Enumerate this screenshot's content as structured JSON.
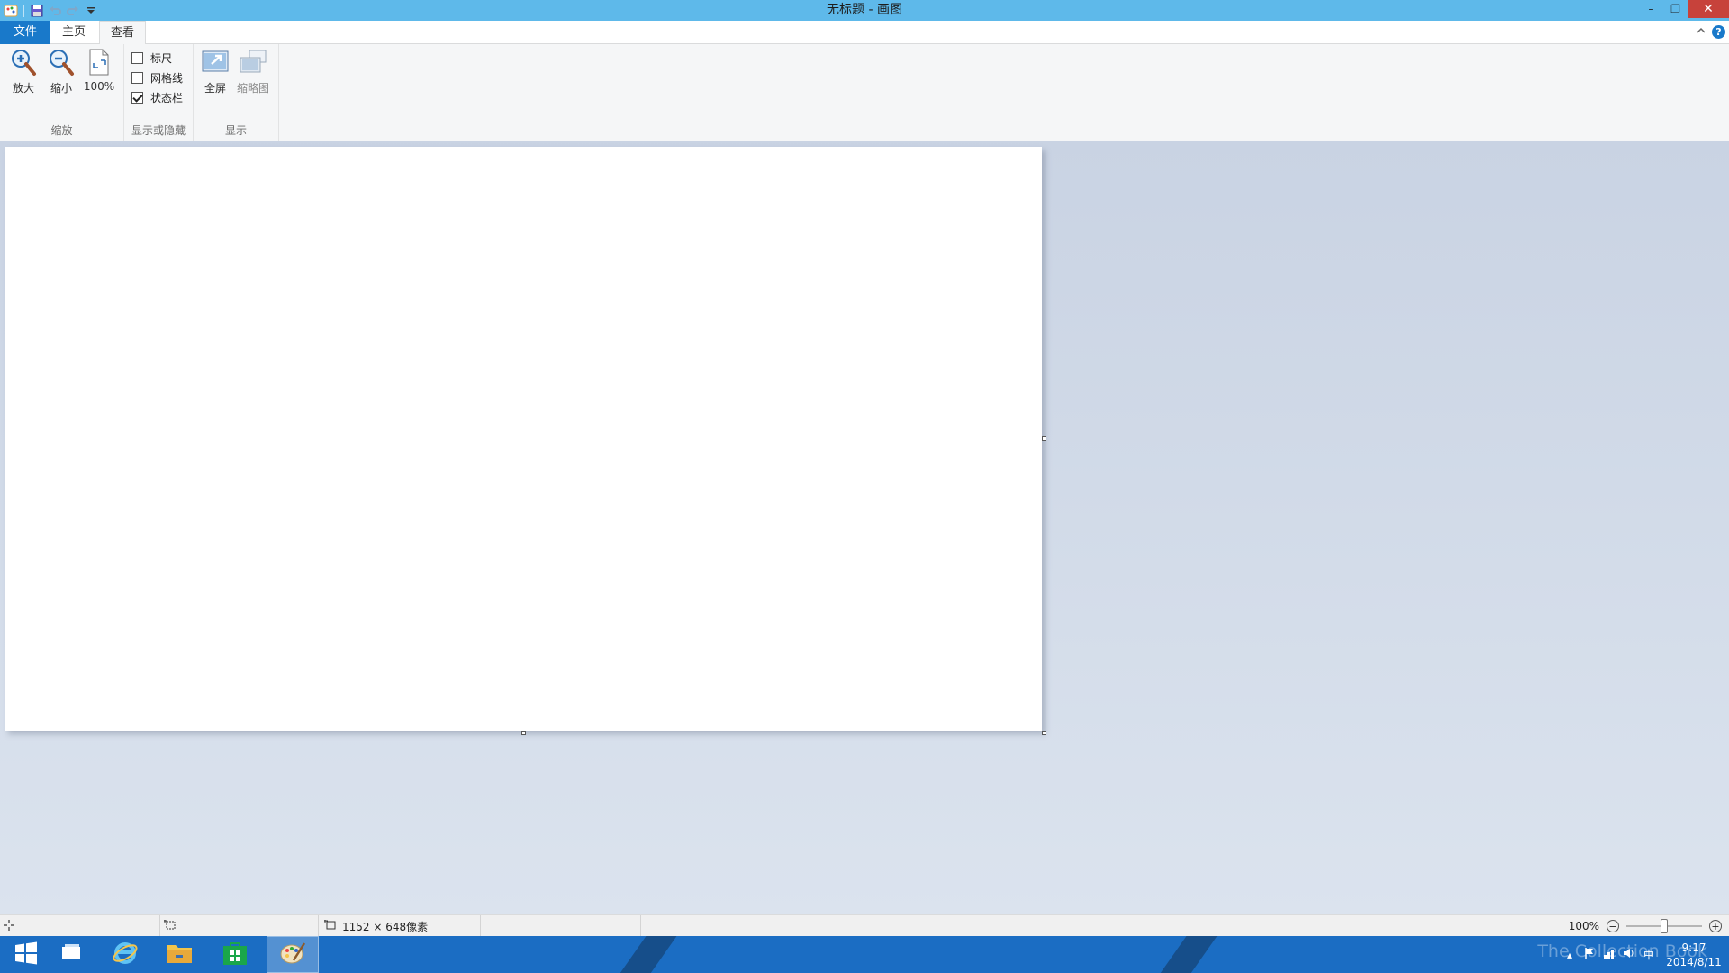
{
  "window": {
    "title": "无标题 - 画图",
    "controls": {
      "minimize": "–",
      "restore": "❐",
      "close": "✕"
    }
  },
  "quick_access": {
    "icons": [
      "paint-app-icon",
      "save-icon",
      "undo-icon",
      "redo-icon",
      "customize-dropdown-icon"
    ]
  },
  "tabs": [
    {
      "label": "文件",
      "active": false
    },
    {
      "label": "主页",
      "active": false
    },
    {
      "label": "查看",
      "active": true
    }
  ],
  "ribbon": {
    "zoom_group": {
      "label": "缩放",
      "zoom_in": "放大",
      "zoom_out": "缩小",
      "actual_size": "100%"
    },
    "show_hide_group": {
      "label": "显示或隐藏",
      "ruler": {
        "label": "标尺",
        "checked": false
      },
      "gridlines": {
        "label": "网格线",
        "checked": false
      },
      "status_bar": {
        "label": "状态栏",
        "checked": true
      }
    },
    "display_group": {
      "label": "显示",
      "fullscreen": "全屏",
      "thumbnail": "缩略图"
    }
  },
  "statusbar": {
    "canvas_size": "1152 × 648像素",
    "zoom_level": "100%",
    "zoom_fraction": 0.5
  },
  "taskbar": {
    "clock_time": "9:17",
    "clock_date": "2014/8/11",
    "input_method": "中",
    "watermark": "The Collection Book",
    "accent": "#1b6dc3"
  },
  "colors": {
    "titlebar": "#5eb9ea",
    "file_tab": "#1979ca",
    "close_button": "#c7423b",
    "workarea": "#d6dfeb"
  }
}
